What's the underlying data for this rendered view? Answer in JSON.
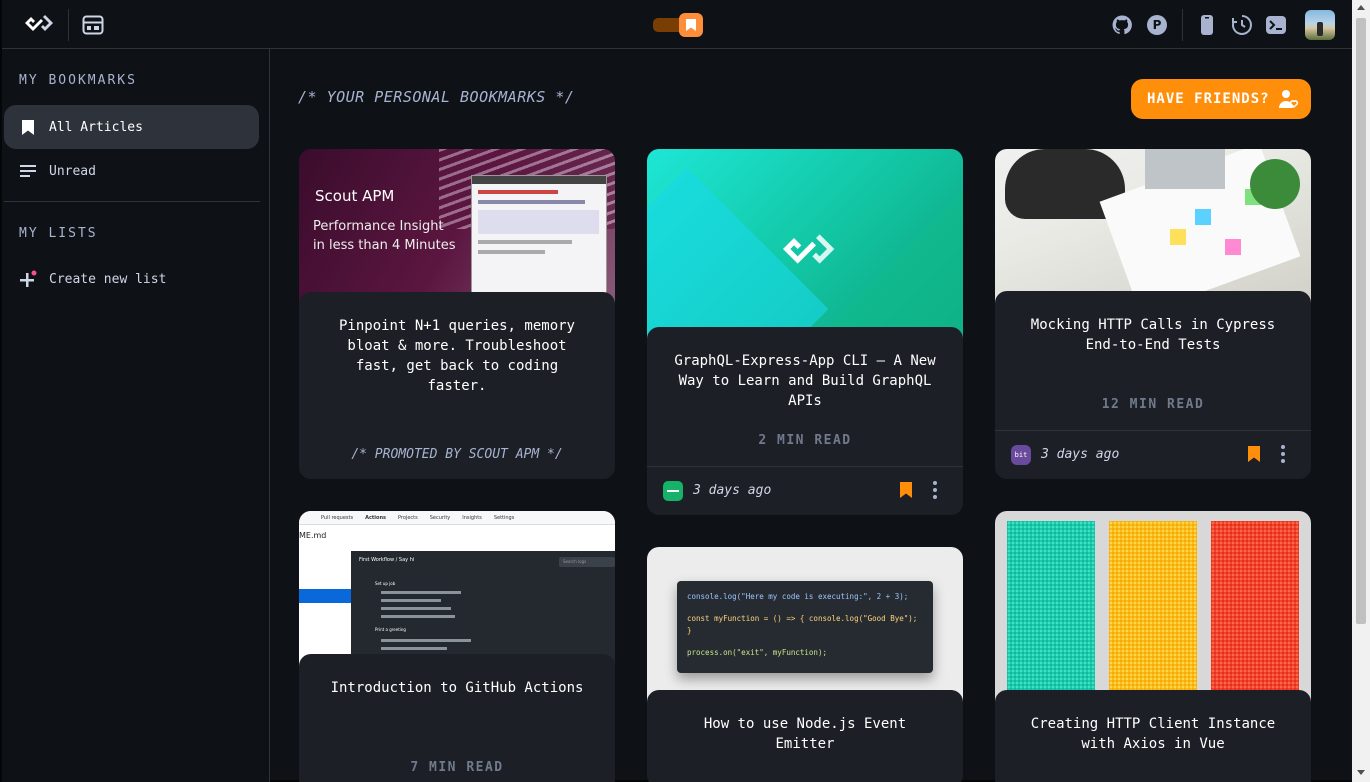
{
  "header": {
    "logo": "daily-dev-logo",
    "layout_icon": "layout-icon",
    "toggle_state": "on",
    "right_icons": [
      "github-icon",
      "producthunt-icon",
      "mobile-icon",
      "history-icon",
      "terminal-icon"
    ],
    "producthunt_letter": "P"
  },
  "sidebar": {
    "section1": "MY BOOKMARKS",
    "items": [
      {
        "label": "All Articles",
        "icon": "bookmark-icon",
        "active": true
      },
      {
        "label": "Unread",
        "icon": "list-icon",
        "active": false
      }
    ],
    "section2": "MY LISTS",
    "create_list": "Create new list"
  },
  "main": {
    "title": "/* YOUR PERSONAL BOOKMARKS */",
    "friends_button": "HAVE FRIENDS?"
  },
  "promo_image": {
    "brand": "Scout APM",
    "line1": "Performance Insight",
    "line2": "in less than 4 Minutes"
  },
  "github_image": {
    "tabs": [
      "Pull requests",
      "Actions",
      "Projects",
      "Security",
      "Insights",
      "Settings"
    ],
    "file": "ME.md",
    "workflow": "First Workflow / Say hi",
    "search": "Search logs",
    "step1": "Set up job",
    "step2": "Print a greeting"
  },
  "code_image": {
    "line1": "console.log(\"Here my code is executing:\", 2 + 3);",
    "line2": "const myFunction = () => { console.log(\"Good Bye\"); }",
    "line3": "process.on(\"exit\", myFunction);"
  },
  "cards": [
    {
      "title": "Pinpoint N+1 queries, memory bloat & more. Troubleshoot fast, get back to coding faster.",
      "promo": "/* PROMOTED BY SCOUT APM */"
    },
    {
      "title": "GraphQL-Express-App CLI — A New Way to Learn and Build GraphQL APIs",
      "read": "2 MIN READ",
      "date": "3 days ago"
    },
    {
      "title": "Mocking HTTP Calls in Cypress End-to-End Tests",
      "read": "12 MIN READ",
      "date": "3 days ago",
      "source": "bit"
    },
    {
      "title": "Introduction to GitHub Actions",
      "read": "7 MIN READ"
    },
    {
      "title": "How to use Node.js Event Emitter"
    },
    {
      "title": "Creating HTTP Client Instance with Axios in Vue"
    }
  ],
  "colors": {
    "accent": "#ff8e0b",
    "background": "#0e1217",
    "card": "#1c1f26"
  }
}
